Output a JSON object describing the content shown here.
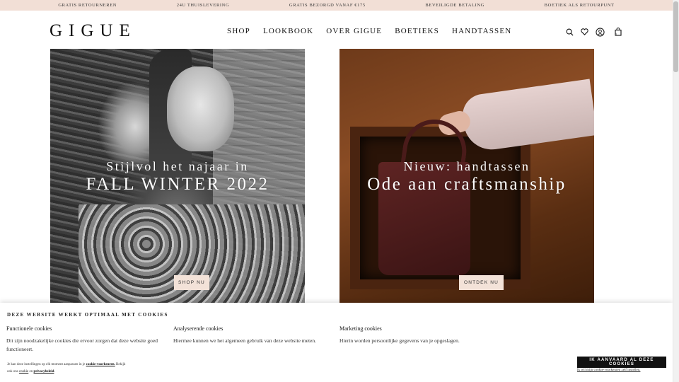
{
  "promo": {
    "items": [
      "Gratis retourneren",
      "24u thuislevering",
      "Gratis bezorgd vanaf €175",
      "Beveiligde betaling",
      "Boetiek als retourpunt"
    ]
  },
  "header": {
    "logo": "GIGUE",
    "nav": [
      "SHOP",
      "LOOKBOOK",
      "OVER GIGUE",
      "BOETIEKS",
      "HANDTASSEN"
    ],
    "bag_count": "0"
  },
  "hero": {
    "left": {
      "subtitle": "Stijlvol het najaar in",
      "title": "FALL WINTER 2022",
      "button": "Shop nu"
    },
    "right": {
      "subtitle": "Nieuw: handtassen",
      "title": "Ode aan craftsmanship",
      "button": "Ontdek nu"
    }
  },
  "cookie": {
    "title": "Deze website werkt optimaal met cookies",
    "functional": {
      "heading": "Functionele cookies",
      "text": "Dit zijn noodzakelijke cookies die ervoor zorgen dat deze website goed functioneert."
    },
    "analytics": {
      "heading": "Analyserende cookies",
      "text": "Hiermee kunnen we het algemeen gebruik van deze website meten."
    },
    "marketing": {
      "heading": "Marketing cookies",
      "text": "Hierin worden persoonlijke gegevens van je opgeslagen."
    },
    "note_prefix": "Je kan deze instellingen op elk moment aanpassen in je ",
    "note_link1": "cookie-voorkeuren.",
    "note_mid": " Bekijk ook ons ",
    "note_link2": "cookie",
    "note_and": " en ",
    "note_link3": "privacybeleid",
    "note_end": ".",
    "accept_button": "Ik aanvaard al deze cookies",
    "self_link": "Ik wil mijn cookie-voorkeuren zelf instellen."
  }
}
